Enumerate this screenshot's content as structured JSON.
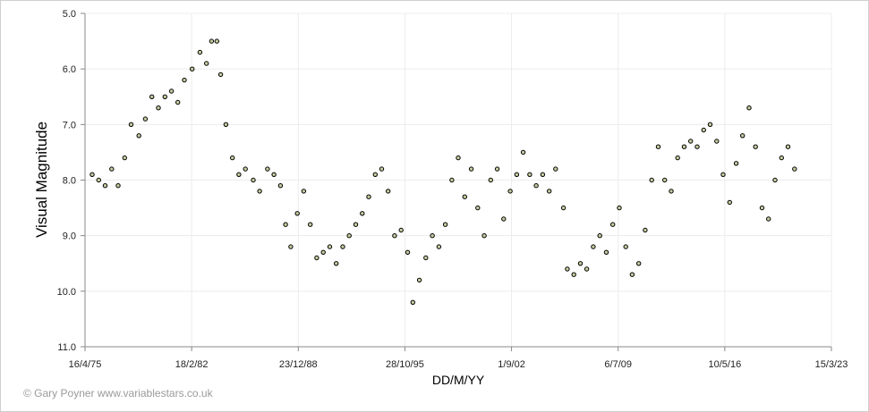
{
  "chart_data": {
    "type": "scatter",
    "title": "",
    "xlabel": "DD/M/YY",
    "ylabel": "Visual Magnitude",
    "credit": "© Gary Poyner www.variablestars.co.uk",
    "x_axis": {
      "type": "date",
      "range": [
        "1975-04-16",
        "2023-03-15"
      ],
      "ticks": [
        "1975-04-16",
        "1982-02-18",
        "1988-12-23",
        "1995-10-28",
        "2002-09-01",
        "2009-07-06",
        "2016-05-10",
        "2023-03-15"
      ],
      "tick_labels": [
        "16/4/75",
        "18/2/82",
        "23/12/88",
        "28/10/95",
        "1/9/02",
        "6/7/09",
        "10/5/16",
        "15/3/23"
      ]
    },
    "y_axis": {
      "inverted": true,
      "range": [
        5.0,
        11.0
      ],
      "ticks": [
        5.0,
        6.0,
        7.0,
        8.0,
        9.0,
        10.0,
        11.0
      ],
      "tick_labels": [
        "5.0",
        "6.0",
        "7.0",
        "8.0",
        "9.0",
        "10.0",
        "11.0"
      ]
    },
    "grid": true,
    "marker": {
      "shape": "circle",
      "fill": "#c8cca0",
      "stroke": "#000000"
    },
    "series": [
      {
        "points": [
          [
            "1975-10-01",
            7.9
          ],
          [
            "1976-03-01",
            8.0
          ],
          [
            "1976-08-01",
            8.1
          ],
          [
            "1977-01-01",
            7.8
          ],
          [
            "1977-06-01",
            8.1
          ],
          [
            "1977-11-01",
            7.6
          ],
          [
            "1978-04-01",
            7.0
          ],
          [
            "1978-10-01",
            7.2
          ],
          [
            "1979-03-01",
            6.9
          ],
          [
            "1979-08-01",
            6.5
          ],
          [
            "1980-01-01",
            6.7
          ],
          [
            "1980-06-01",
            6.5
          ],
          [
            "1980-11-01",
            6.4
          ],
          [
            "1981-04-01",
            6.6
          ],
          [
            "1981-09-01",
            6.2
          ],
          [
            "1982-03-01",
            6.0
          ],
          [
            "1982-09-01",
            5.7
          ],
          [
            "1983-02-01",
            5.9
          ],
          [
            "1983-06-01",
            5.5
          ],
          [
            "1983-10-01",
            5.5
          ],
          [
            "1984-01-01",
            6.1
          ],
          [
            "1984-05-01",
            7.0
          ],
          [
            "1984-10-01",
            7.6
          ],
          [
            "1985-03-01",
            7.9
          ],
          [
            "1985-08-01",
            7.8
          ],
          [
            "1986-02-01",
            8.0
          ],
          [
            "1986-07-01",
            8.2
          ],
          [
            "1987-01-01",
            7.8
          ],
          [
            "1987-06-01",
            7.9
          ],
          [
            "1987-11-01",
            8.1
          ],
          [
            "1988-03-01",
            8.8
          ],
          [
            "1988-07-01",
            9.2
          ],
          [
            "1988-12-01",
            8.6
          ],
          [
            "1989-05-01",
            8.2
          ],
          [
            "1989-10-01",
            8.8
          ],
          [
            "1990-03-01",
            9.4
          ],
          [
            "1990-08-01",
            9.3
          ],
          [
            "1991-01-01",
            9.2
          ],
          [
            "1991-06-01",
            9.5
          ],
          [
            "1991-11-01",
            9.2
          ],
          [
            "1992-04-01",
            9.0
          ],
          [
            "1992-09-01",
            8.8
          ],
          [
            "1993-02-01",
            8.6
          ],
          [
            "1993-07-01",
            8.3
          ],
          [
            "1993-12-01",
            7.9
          ],
          [
            "1994-05-01",
            7.8
          ],
          [
            "1994-10-01",
            8.2
          ],
          [
            "1995-03-01",
            9.0
          ],
          [
            "1995-08-01",
            8.9
          ],
          [
            "1996-01-01",
            9.3
          ],
          [
            "1996-05-01",
            10.2
          ],
          [
            "1996-10-01",
            9.8
          ],
          [
            "1997-03-01",
            9.4
          ],
          [
            "1997-08-01",
            9.0
          ],
          [
            "1998-01-01",
            9.2
          ],
          [
            "1998-06-01",
            8.8
          ],
          [
            "1998-11-01",
            8.0
          ],
          [
            "1999-04-01",
            7.6
          ],
          [
            "1999-09-01",
            8.3
          ],
          [
            "2000-02-01",
            7.8
          ],
          [
            "2000-07-01",
            8.5
          ],
          [
            "2000-12-01",
            9.0
          ],
          [
            "2001-05-01",
            8.0
          ],
          [
            "2001-10-01",
            7.8
          ],
          [
            "2002-03-01",
            8.7
          ],
          [
            "2002-08-01",
            8.2
          ],
          [
            "2003-01-01",
            7.9
          ],
          [
            "2003-06-01",
            7.5
          ],
          [
            "2003-11-01",
            7.9
          ],
          [
            "2004-04-01",
            8.1
          ],
          [
            "2004-09-01",
            7.9
          ],
          [
            "2005-02-01",
            8.2
          ],
          [
            "2005-07-01",
            7.8
          ],
          [
            "2006-01-01",
            8.5
          ],
          [
            "2006-04-01",
            9.6
          ],
          [
            "2006-09-01",
            9.7
          ],
          [
            "2007-02-01",
            9.5
          ],
          [
            "2007-07-01",
            9.6
          ],
          [
            "2007-12-01",
            9.2
          ],
          [
            "2008-05-01",
            9.0
          ],
          [
            "2008-10-01",
            9.3
          ],
          [
            "2009-03-01",
            8.8
          ],
          [
            "2009-08-01",
            8.5
          ],
          [
            "2010-01-01",
            9.2
          ],
          [
            "2010-06-01",
            9.7
          ],
          [
            "2010-11-01",
            9.5
          ],
          [
            "2011-04-01",
            8.9
          ],
          [
            "2011-09-01",
            8.0
          ],
          [
            "2012-02-01",
            7.4
          ],
          [
            "2012-07-01",
            8.0
          ],
          [
            "2012-12-01",
            8.2
          ],
          [
            "2013-05-01",
            7.6
          ],
          [
            "2013-10-01",
            7.4
          ],
          [
            "2014-03-01",
            7.3
          ],
          [
            "2014-08-01",
            7.4
          ],
          [
            "2015-01-01",
            7.1
          ],
          [
            "2015-06-01",
            7.0
          ],
          [
            "2015-11-01",
            7.3
          ],
          [
            "2016-04-01",
            7.9
          ],
          [
            "2016-09-01",
            8.4
          ],
          [
            "2017-02-01",
            7.7
          ],
          [
            "2017-07-01",
            7.2
          ],
          [
            "2017-12-01",
            6.7
          ],
          [
            "2018-05-01",
            7.4
          ],
          [
            "2018-10-01",
            8.5
          ],
          [
            "2019-03-01",
            8.7
          ],
          [
            "2019-08-01",
            8.0
          ],
          [
            "2020-01-01",
            7.6
          ],
          [
            "2020-06-01",
            7.4
          ],
          [
            "2020-11-01",
            7.8
          ]
        ]
      }
    ]
  }
}
